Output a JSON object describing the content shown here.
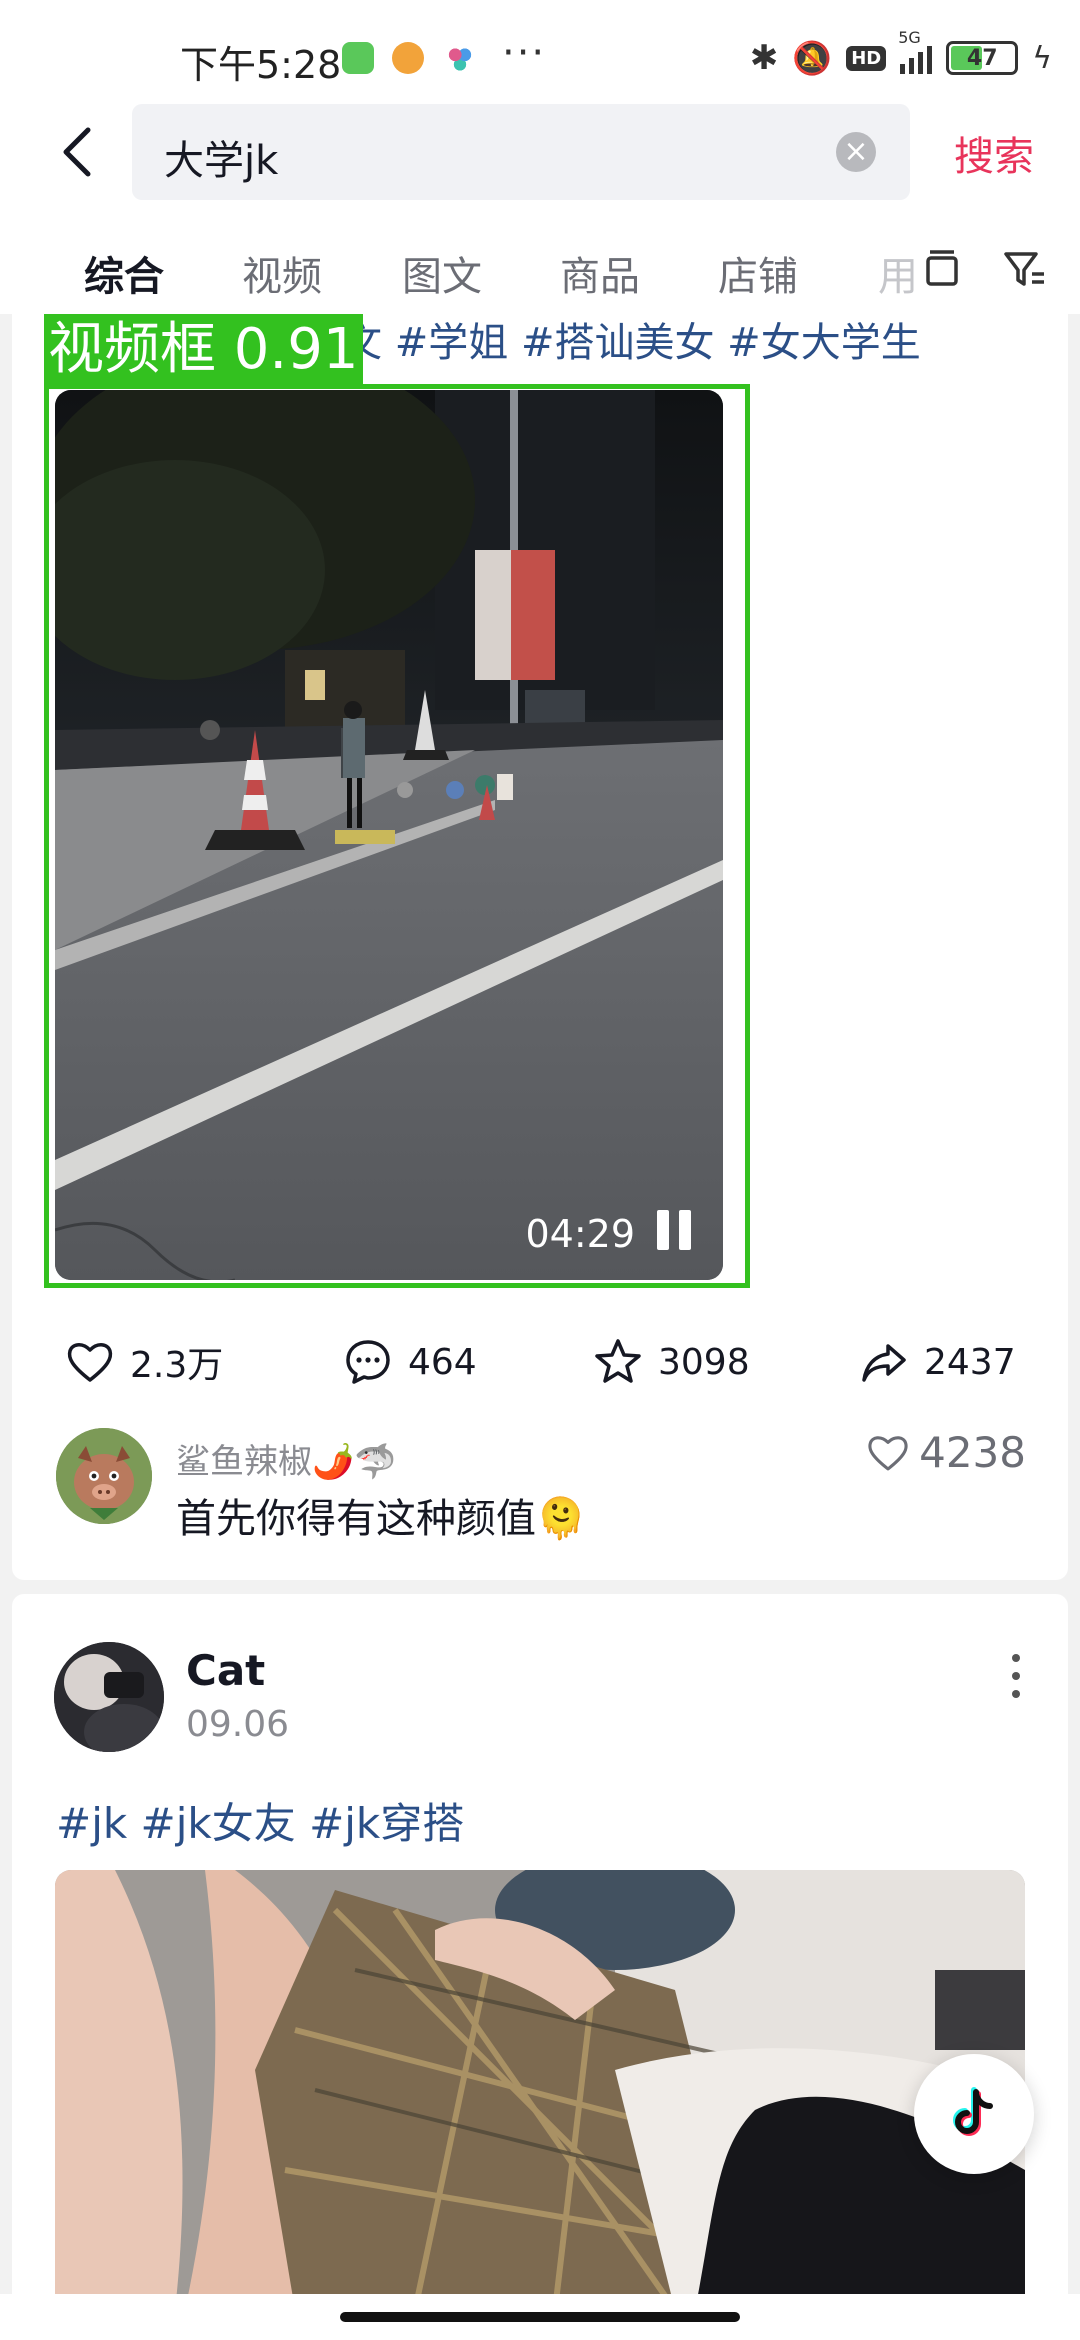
{
  "status_bar": {
    "time": "下午5:28",
    "battery": "47",
    "more": "···",
    "network": "5G"
  },
  "search": {
    "query": "大学jk",
    "button": "搜索"
  },
  "tabs": [
    "综合",
    "视频",
    "图文",
    "商品",
    "店铺",
    "用"
  ],
  "post1": {
    "tagline": "文 #学姐 #搭讪美女 #女大学生",
    "duration": "04:29",
    "detection_label": "视频框 0.91",
    "likes": "2.3万",
    "comments": "464",
    "favorites": "3098",
    "shares": "2437",
    "top_comment": {
      "user": "鲨鱼辣椒🌶️🦈",
      "text": "首先你得有这种颜值🫠",
      "likes": "4238"
    }
  },
  "post2": {
    "author": "Cat",
    "date": "09.06",
    "hashtags": "#jk #jk女友 #jk穿搭"
  },
  "colors": {
    "accent": "#e8345b",
    "hashtag": "#2b4f87",
    "detection": "#33c11f"
  }
}
